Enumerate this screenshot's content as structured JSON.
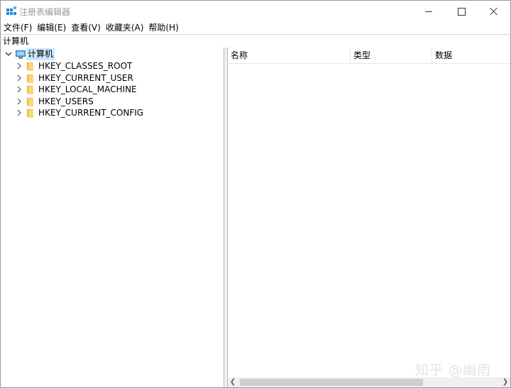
{
  "window": {
    "title": "注册表编辑器",
    "accent": "#1e8ad6"
  },
  "menu": {
    "items": [
      {
        "label": "文件(F)"
      },
      {
        "label": "编辑(E)"
      },
      {
        "label": "查看(V)"
      },
      {
        "label": "收藏夹(A)"
      },
      {
        "label": "帮助(H)"
      }
    ]
  },
  "address": {
    "value": "计算机"
  },
  "tree": {
    "root": {
      "label": "计算机",
      "icon": "computer-icon",
      "expanded": true,
      "selected": true
    },
    "children": [
      {
        "label": "HKEY_CLASSES_ROOT",
        "icon": "folder-icon"
      },
      {
        "label": "HKEY_CURRENT_USER",
        "icon": "folder-icon"
      },
      {
        "label": "HKEY_LOCAL_MACHINE",
        "icon": "folder-icon"
      },
      {
        "label": "HKEY_USERS",
        "icon": "folder-icon"
      },
      {
        "label": "HKEY_CURRENT_CONFIG",
        "icon": "folder-icon"
      }
    ]
  },
  "list": {
    "columns": [
      {
        "label": "名称"
      },
      {
        "label": "类型"
      },
      {
        "label": "数据"
      }
    ]
  },
  "watermark": {
    "text": "知乎 @幽雨"
  }
}
